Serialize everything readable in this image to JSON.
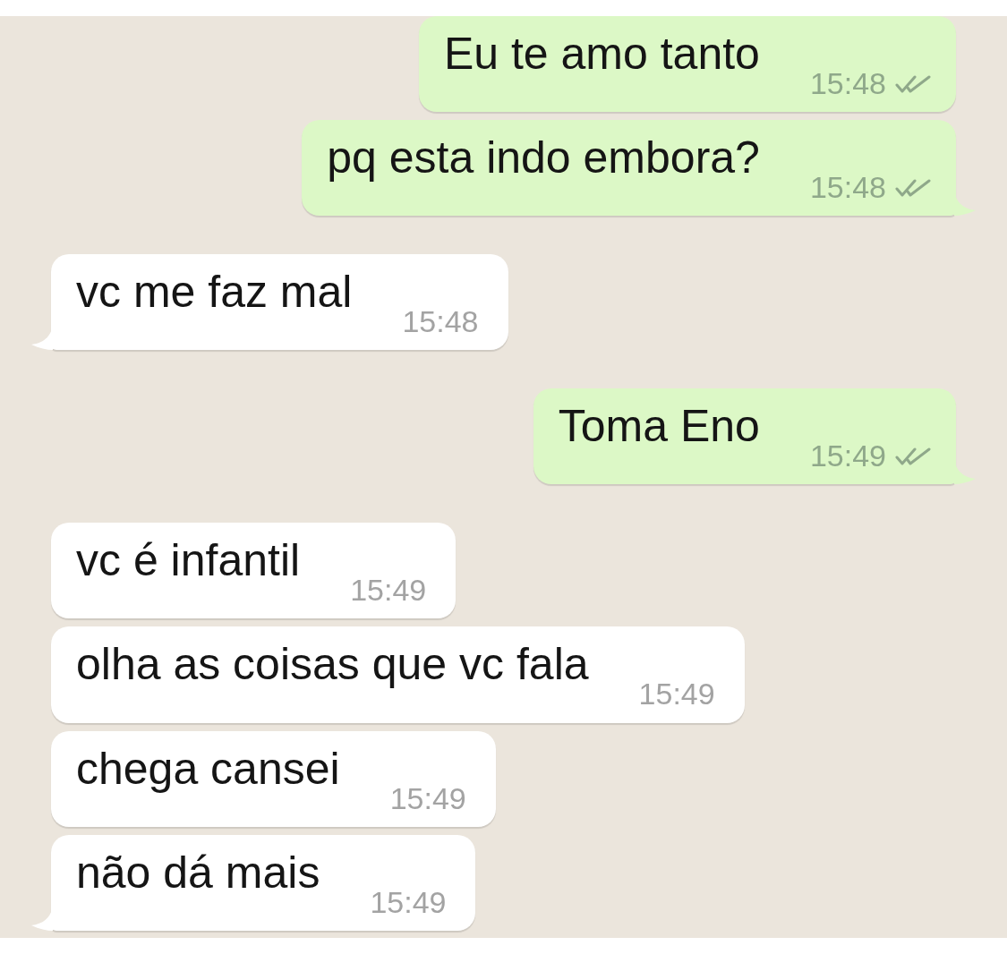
{
  "messages": [
    {
      "kind": "outgoing",
      "text": "Eu te amo tanto",
      "time": "15:48",
      "read": false,
      "tail": false
    },
    {
      "kind": "outgoing",
      "text": "pq esta indo embora?",
      "time": "15:48",
      "read": false,
      "tail": true
    },
    {
      "kind": "incoming",
      "text": "vc me faz mal",
      "time": "15:48",
      "tail": true
    },
    {
      "kind": "outgoing",
      "text": "Toma Eno",
      "time": "15:49",
      "read": false,
      "tail": true
    },
    {
      "kind": "incoming",
      "text": "vc é infantil",
      "time": "15:49",
      "tail": false
    },
    {
      "kind": "incoming",
      "text": "olha as coisas que vc fala",
      "time": "15:49",
      "tail": false
    },
    {
      "kind": "incoming",
      "text": "chega cansei",
      "time": "15:49",
      "tail": false
    },
    {
      "kind": "incoming",
      "text": "não dá mais",
      "time": "15:49",
      "tail": true
    }
  ]
}
